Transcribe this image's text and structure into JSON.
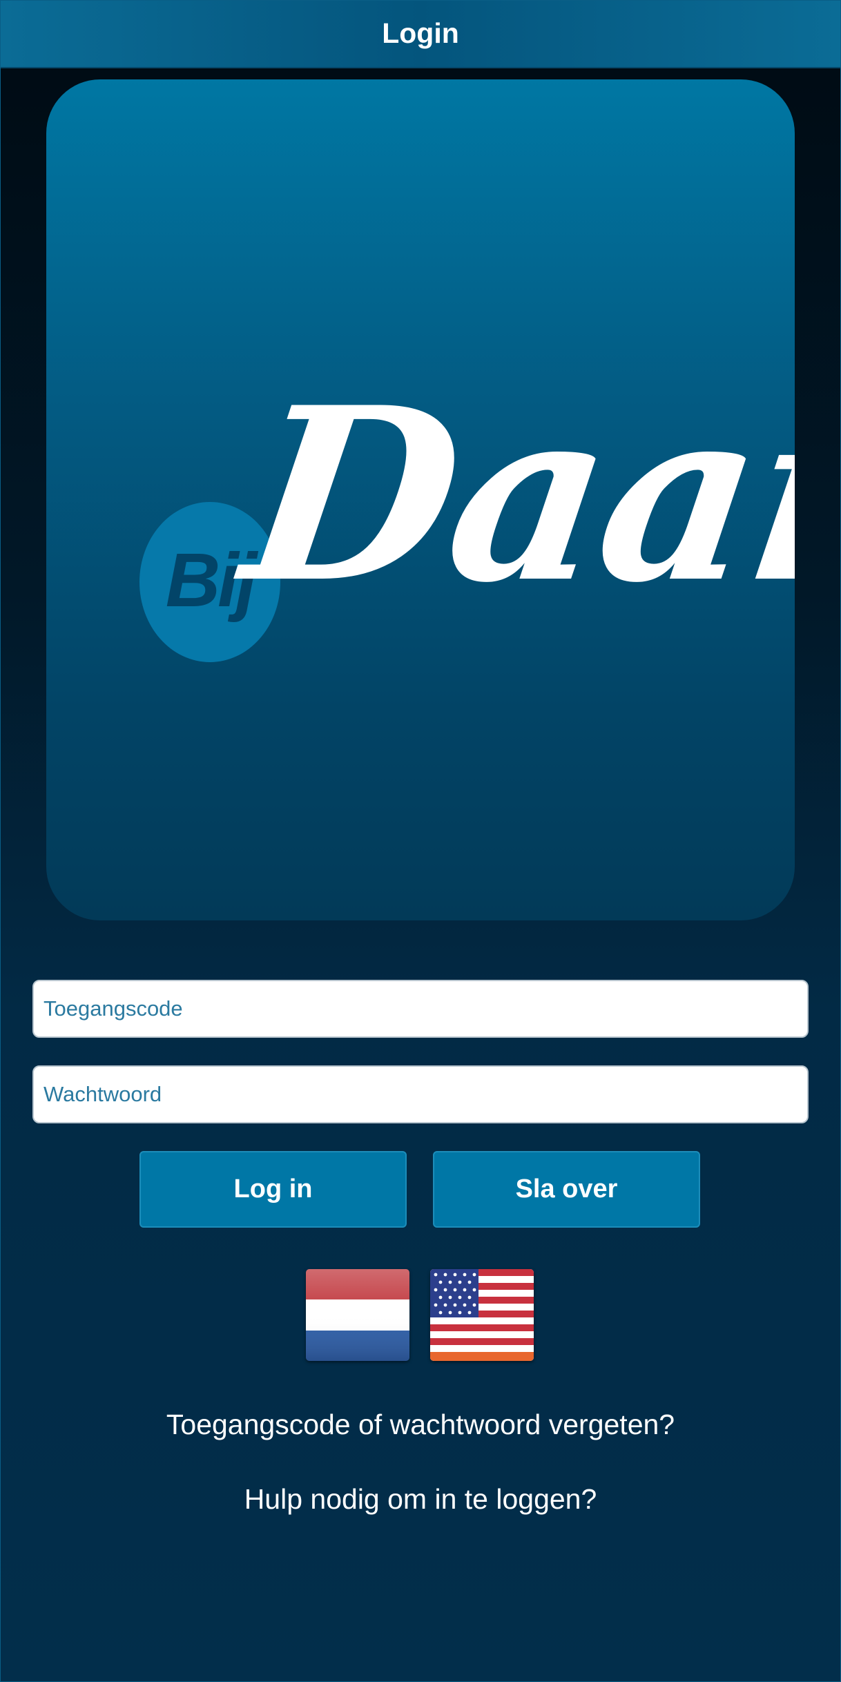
{
  "header": {
    "title": "Login"
  },
  "logo": {
    "badge_text": "Bij",
    "wordmark": "Daan"
  },
  "form": {
    "code_placeholder": "Toegangscode",
    "code_value": "",
    "password_placeholder": "Wachtwoord",
    "password_value": ""
  },
  "buttons": {
    "login_label": "Log in",
    "skip_label": "Sla over"
  },
  "languages": [
    {
      "icon": "netherlands-flag-icon"
    },
    {
      "icon": "usa-flag-icon"
    }
  ],
  "links": {
    "forgot": "Toegangscode of wachtwoord vergeten?",
    "help": "Hulp nodig om in te loggen?"
  },
  "colors": {
    "header_bg": "#04557d",
    "button_bg": "#0077a6",
    "badge_bg": "#0679aa",
    "text_accent": "#1a6f96"
  }
}
